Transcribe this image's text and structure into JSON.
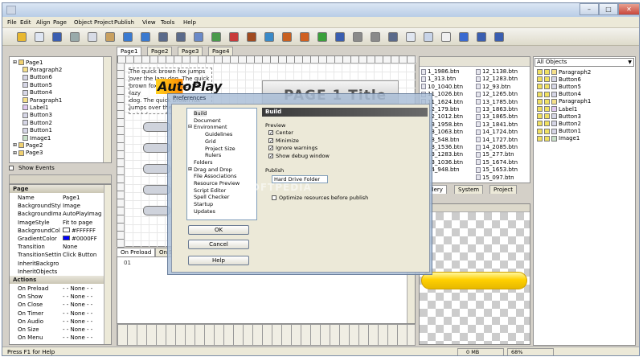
{
  "menu": [
    "File",
    "Edit",
    "Align",
    "Page",
    "Object",
    "Project",
    "Publish",
    "View",
    "Tools",
    "Help"
  ],
  "page_tree": {
    "items": [
      {
        "label": "Page1",
        "kind": "page",
        "depth": 0
      },
      {
        "label": "Paragraph2",
        "kind": "paragraph",
        "depth": 1
      },
      {
        "label": "Button6",
        "kind": "button",
        "depth": 1
      },
      {
        "label": "Button5",
        "kind": "button",
        "depth": 1
      },
      {
        "label": "Button4",
        "kind": "button",
        "depth": 1
      },
      {
        "label": "Paragraph1",
        "kind": "paragraph",
        "depth": 1
      },
      {
        "label": "Label1",
        "kind": "label",
        "depth": 1
      },
      {
        "label": "Button3",
        "kind": "button",
        "depth": 1
      },
      {
        "label": "Button2",
        "kind": "button",
        "depth": 1
      },
      {
        "label": "Button1",
        "kind": "button",
        "depth": 1
      },
      {
        "label": "Image1",
        "kind": "image",
        "depth": 1
      },
      {
        "label": "Page2",
        "kind": "page",
        "depth": 0
      },
      {
        "label": "Page3",
        "kind": "page",
        "depth": 0
      }
    ],
    "show_events": "Show Events"
  },
  "properties": {
    "page_header": "Page",
    "rows": [
      {
        "key": "Name",
        "value": "Page1"
      },
      {
        "key": "BackgroundStyl",
        "value": "Image"
      },
      {
        "key": "BackgroundIma",
        "value": "AutoPlayImag"
      },
      {
        "key": "ImageStyle",
        "value": "Fit to page"
      },
      {
        "key": "BackgroundCol",
        "value": "#FFFFFF",
        "swatch": "#ffffff"
      },
      {
        "key": "GradientColor",
        "value": "#0000FF",
        "swatch": "#0000ff"
      },
      {
        "key": "Transition",
        "value": "None"
      },
      {
        "key": "TransitionSettin",
        "value": "Click Button"
      },
      {
        "key": "InheritBackgro",
        "value": ""
      },
      {
        "key": "InheritObjects",
        "value": ""
      }
    ],
    "actions_header": "Actions",
    "actions": [
      {
        "key": "On Preload",
        "value": "- - None - -"
      },
      {
        "key": "On Show",
        "value": "- - None - -"
      },
      {
        "key": "On Close",
        "value": "- - None - -"
      },
      {
        "key": "On Timer",
        "value": "- - None - -"
      },
      {
        "key": "On Audio",
        "value": "- - None - -"
      },
      {
        "key": "On Size",
        "value": "- - None - -"
      },
      {
        "key": "On Menu",
        "value": "- - None - -"
      }
    ]
  },
  "doc_tabs": [
    "Page1",
    "Page2",
    "Page3",
    "Page4"
  ],
  "canvas": {
    "paragraph_lines": [
      "The quick brown fox jumps",
      "over the lazy dog. The quick",
      "brown fox jumps over the lazy",
      "dog. The quick brown fox",
      "jumps over the lazy dog. The",
      "quick brown fox"
    ],
    "logo_text": "AutoPlay",
    "banner_text": "PAGE 1 Title"
  },
  "script_tabs": [
    "On Preload",
    "On Sh"
  ],
  "script_line": "01",
  "file_list": {
    "col1": [
      "1_1986.btn",
      "1_313.btn",
      "10_1040.btn",
      "11_1026.btn",
      "11_1624.btn",
      "12_179.btn",
      "12_1012.btn",
      "13_1958.btn",
      "13_1063.btn",
      "13_548.btn",
      "13_1536.btn",
      "13_1283.btn",
      "13_1036.btn",
      "14_948.btn"
    ],
    "col2": [
      "12_1138.btn",
      "12_1283.btn",
      "12_93.btn",
      "12_1265.btn",
      "13_1785.btn",
      "13_1863.btn",
      "13_1865.btn",
      "13_1841.btn",
      "14_1724.btn",
      "14_1727.btn",
      "14_2085.btn",
      "15_277.btn",
      "15_1674.btn",
      "15_1653.btn",
      "15_097.btn"
    ]
  },
  "gallery_tabs": [
    "Gallery",
    "System",
    "Project"
  ],
  "objects_panel": {
    "dropdown": "All Objects",
    "items": [
      "Paragraph2",
      "Button6",
      "Button5",
      "Button4",
      "Paragraph1",
      "Label1",
      "Button3",
      "Button2",
      "Button1",
      "Image1"
    ]
  },
  "dialog": {
    "title": "Preferences",
    "buttons": {
      "ok": "OK",
      "cancel": "Cancel",
      "help": "Help"
    },
    "tree": [
      {
        "label": "Build",
        "depth": 0
      },
      {
        "label": "Document",
        "depth": 0
      },
      {
        "label": "Environment",
        "depth": 0,
        "expander": "-"
      },
      {
        "label": "Guidelines",
        "depth": 1
      },
      {
        "label": "Grid",
        "depth": 1
      },
      {
        "label": "Project Size",
        "depth": 1
      },
      {
        "label": "Rulers",
        "depth": 1
      },
      {
        "label": "Folders",
        "depth": 0
      },
      {
        "label": "Drag and Drop",
        "depth": 0,
        "expander": "+"
      },
      {
        "label": "File Associations",
        "depth": 0
      },
      {
        "label": "Resource Preview",
        "depth": 0
      },
      {
        "label": "Script Editor",
        "depth": 0
      },
      {
        "label": "Spell Checker",
        "depth": 0
      },
      {
        "label": "Startup",
        "depth": 0
      },
      {
        "label": "Updates",
        "depth": 0
      }
    ],
    "section_title": "Build",
    "preview_label": "Preview",
    "preview_options": [
      {
        "label": "Center",
        "checked": true
      },
      {
        "label": "Minimize",
        "checked": true
      },
      {
        "label": "Ignore warnings",
        "checked": true
      },
      {
        "label": "Show debug window",
        "checked": true
      }
    ],
    "publish_label": "Publish",
    "publish_field": "Hard Drive Folder",
    "publish_option": {
      "label": "Optimize resources before publish",
      "checked": false
    }
  },
  "watermark": "SOFTPEDIA",
  "status": {
    "left": "Press F1 for Help",
    "memory": "0 MB",
    "zoom": "68%"
  }
}
